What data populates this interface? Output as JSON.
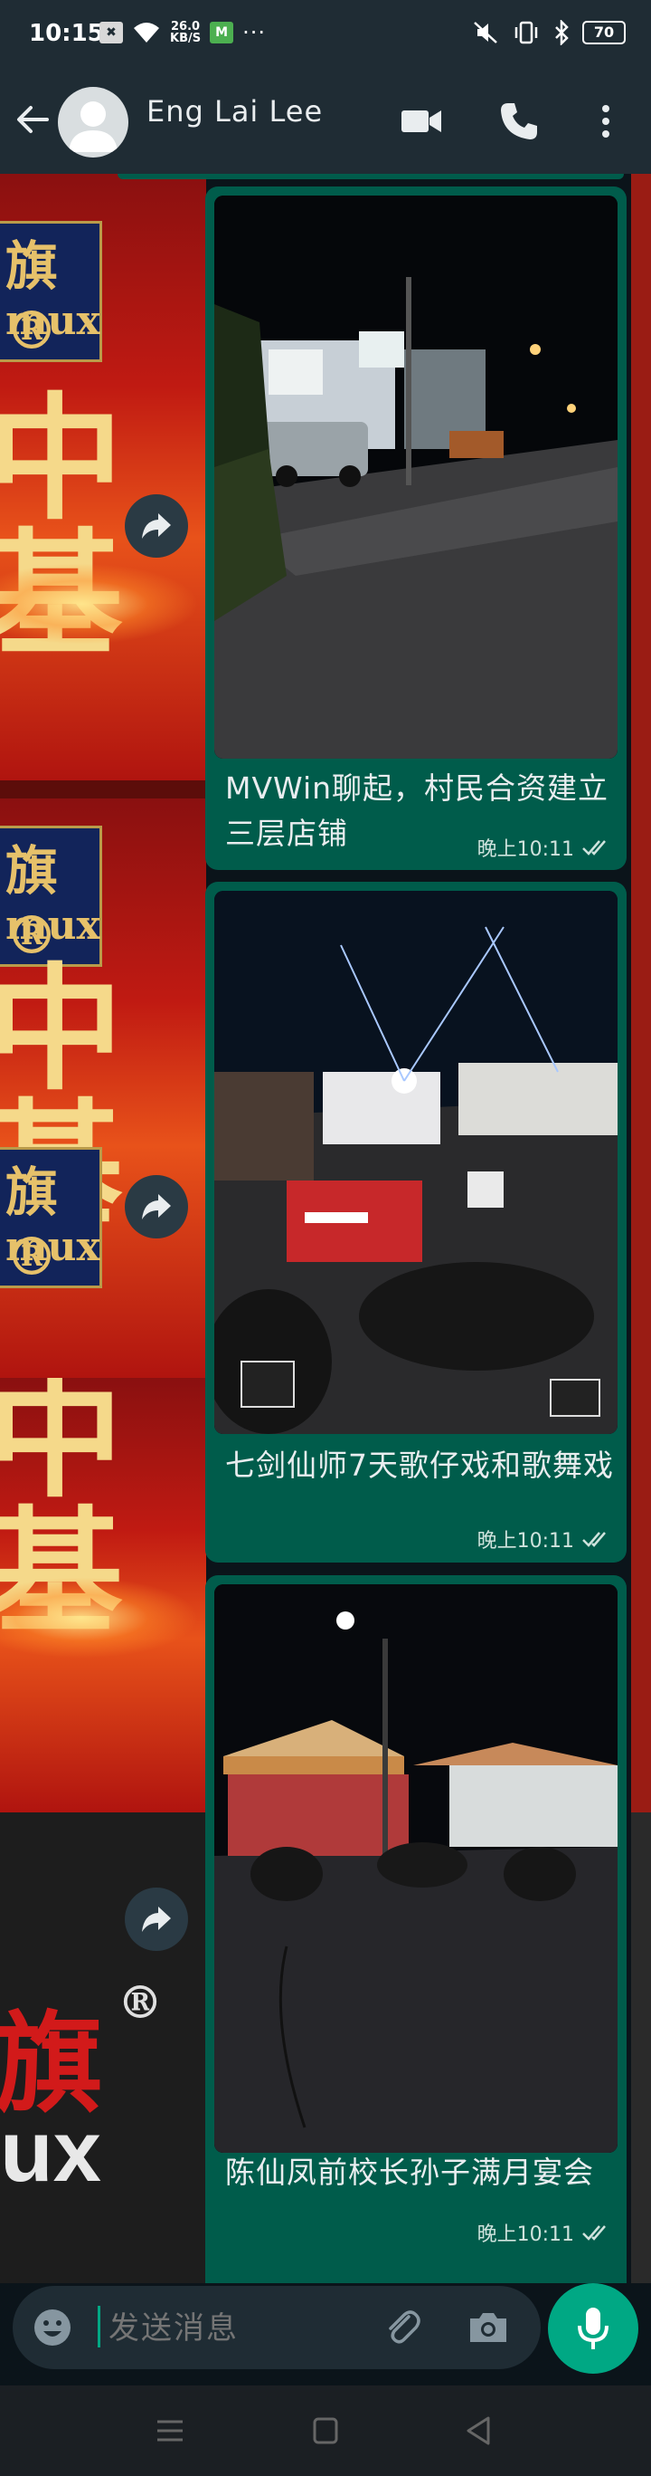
{
  "status_bar": {
    "time": "10:15",
    "notif_box": "✖",
    "speed_value": "26.0",
    "speed_unit": "KB/S",
    "green_app": "M",
    "more": "···",
    "battery": "70"
  },
  "header": {
    "contact_name": "Eng Lai Lee"
  },
  "messages": [
    {
      "caption": "MVWin聊起，村民合资建立三层店铺",
      "time": "晚上10:11"
    },
    {
      "caption": "七剑仙师7天歌仔戏和歌舞戏",
      "time": "晚上10:11"
    },
    {
      "caption": "陈仙凤前校长孙子满月宴会",
      "time": "晚上10:11"
    }
  ],
  "ad": {
    "blue_line1": "旗®",
    "blue_line2": "mux",
    "big_char": "中基",
    "bottom_red": "旗",
    "bottom_reg": "®",
    "bottom_white": "ux"
  },
  "composer": {
    "placeholder": "发送消息"
  },
  "colors": {
    "bubble": "#005c4b",
    "bar": "#1f2c34",
    "accent": "#00a884"
  }
}
